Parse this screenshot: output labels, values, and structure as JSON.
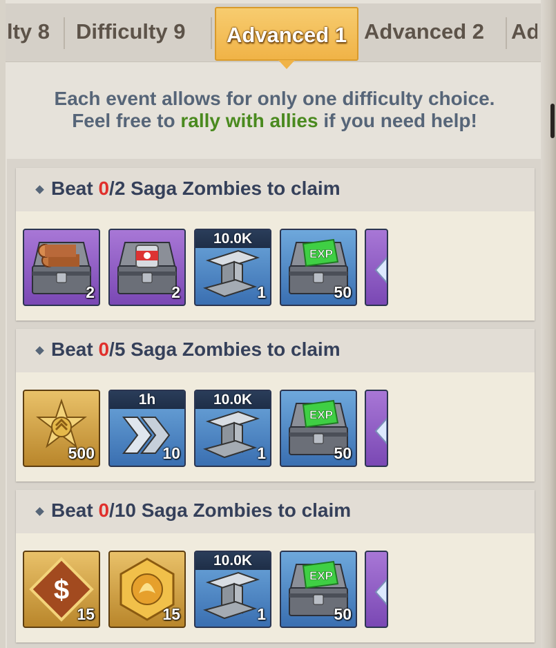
{
  "tabs": [
    {
      "label": "lty 8",
      "active": false
    },
    {
      "label": "Difficulty 9",
      "active": false
    },
    {
      "label": "Advanced 1",
      "active": true
    },
    {
      "label": "Advanced 2",
      "active": false
    },
    {
      "label": "Ad",
      "active": false
    }
  ],
  "info": {
    "line1": "Each event allows for only one difficulty choice.",
    "line2_pre": "Feel free to ",
    "line2_highlight": "rally with allies",
    "line2_post": " if you need help!"
  },
  "milestones": [
    {
      "title_pre": "Beat ",
      "progress": "0",
      "title_total": "/2 Saga Zombies to claim",
      "rewards": [
        {
          "icon": "wood-chest-icon",
          "qty": "2",
          "tier": "purple",
          "band": ""
        },
        {
          "icon": "food-chest-icon",
          "qty": "2",
          "tier": "purple",
          "band": ""
        },
        {
          "icon": "steel-beam-icon",
          "qty": "1",
          "tier": "blue",
          "band": "10.0K"
        },
        {
          "icon": "exp-chest-icon",
          "qty": "50",
          "tier": "blue",
          "band": ""
        },
        {
          "icon": "diamond-icon",
          "qty": "",
          "tier": "purple",
          "band": ""
        }
      ]
    },
    {
      "title_pre": "Beat ",
      "progress": "0",
      "title_total": "/5 Saga Zombies to claim",
      "rewards": [
        {
          "icon": "sheriff-badge-icon",
          "qty": "500",
          "tier": "gold",
          "band": ""
        },
        {
          "icon": "speedup-icon",
          "qty": "10",
          "tier": "blue",
          "band": "1h"
        },
        {
          "icon": "steel-beam-icon",
          "qty": "1",
          "tier": "blue",
          "band": "10.0K"
        },
        {
          "icon": "exp-chest-icon",
          "qty": "50",
          "tier": "blue",
          "band": ""
        },
        {
          "icon": "diamond-icon",
          "qty": "",
          "tier": "purple",
          "band": ""
        }
      ]
    },
    {
      "title_pre": "Beat ",
      "progress": "0",
      "title_total": "/10 Saga Zombies to claim",
      "rewards": [
        {
          "icon": "dollar-token-icon",
          "qty": "15",
          "tier": "gold",
          "band": ""
        },
        {
          "icon": "lion-medal-icon",
          "qty": "15",
          "tier": "gold",
          "band": ""
        },
        {
          "icon": "steel-beam-icon",
          "qty": "1",
          "tier": "blue",
          "band": "10.0K"
        },
        {
          "icon": "exp-chest-icon",
          "qty": "50",
          "tier": "blue",
          "band": ""
        },
        {
          "icon": "diamond-icon",
          "qty": "",
          "tier": "purple",
          "band": ""
        }
      ]
    }
  ],
  "colors": {
    "accent": "#f0b347",
    "progress_red": "#e0302c",
    "highlight_green": "#4a8a1f"
  }
}
